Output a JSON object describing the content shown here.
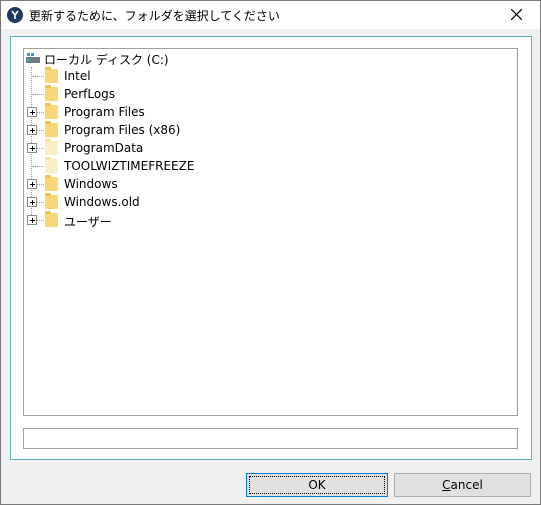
{
  "title": "更新するために、フォルダを選択してください",
  "drive_label": "ローカル ディスク (C:)",
  "folders": [
    {
      "label": "Intel",
      "expandable": false,
      "faded": false
    },
    {
      "label": "PerfLogs",
      "expandable": false,
      "faded": false
    },
    {
      "label": "Program Files",
      "expandable": true,
      "faded": false
    },
    {
      "label": "Program Files (x86)",
      "expandable": true,
      "faded": false
    },
    {
      "label": "ProgramData",
      "expandable": true,
      "faded": true
    },
    {
      "label": "TOOLWIZTIMEFREEZE",
      "expandable": false,
      "faded": true
    },
    {
      "label": "Windows",
      "expandable": true,
      "faded": false
    },
    {
      "label": "Windows.old",
      "expandable": true,
      "faded": false
    },
    {
      "label": "ユーザー",
      "expandable": true,
      "faded": false
    }
  ],
  "path_value": "",
  "buttons": {
    "ok": "OK",
    "cancel_underlined": "C",
    "cancel_rest": "ancel"
  },
  "icons": {
    "app": "app-logo-icon",
    "close": "close-icon",
    "drive": "drive-icon",
    "folder": "folder-icon",
    "expand": "plus-expander-icon"
  },
  "colors": {
    "panel_border": "#5fb5b5",
    "focus_border": "#0078d7",
    "folder": "#f8d775"
  }
}
